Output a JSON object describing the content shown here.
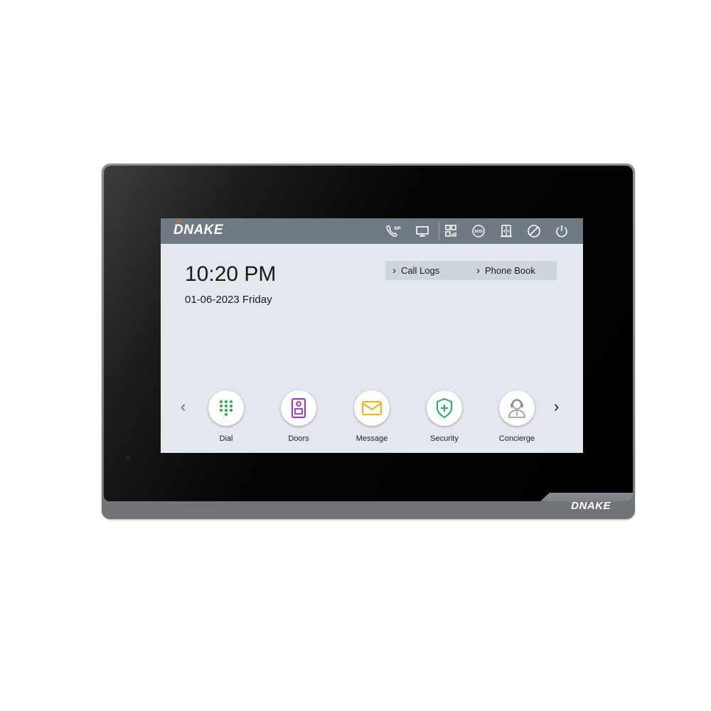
{
  "device": {
    "brand": "DNAKE",
    "frame_logo": "DNAKE"
  },
  "topbar": {
    "logo": "DNAKE",
    "icons": [
      {
        "name": "sip-call-icon",
        "label": "SIP"
      },
      {
        "name": "monitor-icon"
      },
      {
        "name": "qr-code-icon"
      },
      {
        "name": "sos-icon",
        "label": "SOS"
      },
      {
        "name": "door-unlock-icon"
      },
      {
        "name": "do-not-disturb-icon"
      },
      {
        "name": "power-icon"
      }
    ]
  },
  "home": {
    "time": "10:20 PM",
    "date": "01-06-2023 Friday",
    "quick_links": [
      {
        "label": "Call Logs"
      },
      {
        "label": "Phone Book"
      }
    ],
    "apps": [
      {
        "label": "Dial",
        "color": "#22b04b"
      },
      {
        "label": "Doors",
        "color": "#9b30d9"
      },
      {
        "label": "Message",
        "color": "#f5b400"
      },
      {
        "label": "Security",
        "color": "#1fae6e"
      },
      {
        "label": "Concierge",
        "color": "#8a9099"
      }
    ],
    "prev_arrow": "‹",
    "next_arrow": "›",
    "link_chevron": "›"
  },
  "colors": {
    "topbar": "#707a84",
    "screen_bg": "#e3e7ee",
    "links_bg": "#cfd5dd",
    "logo_accent": "#f26522"
  }
}
